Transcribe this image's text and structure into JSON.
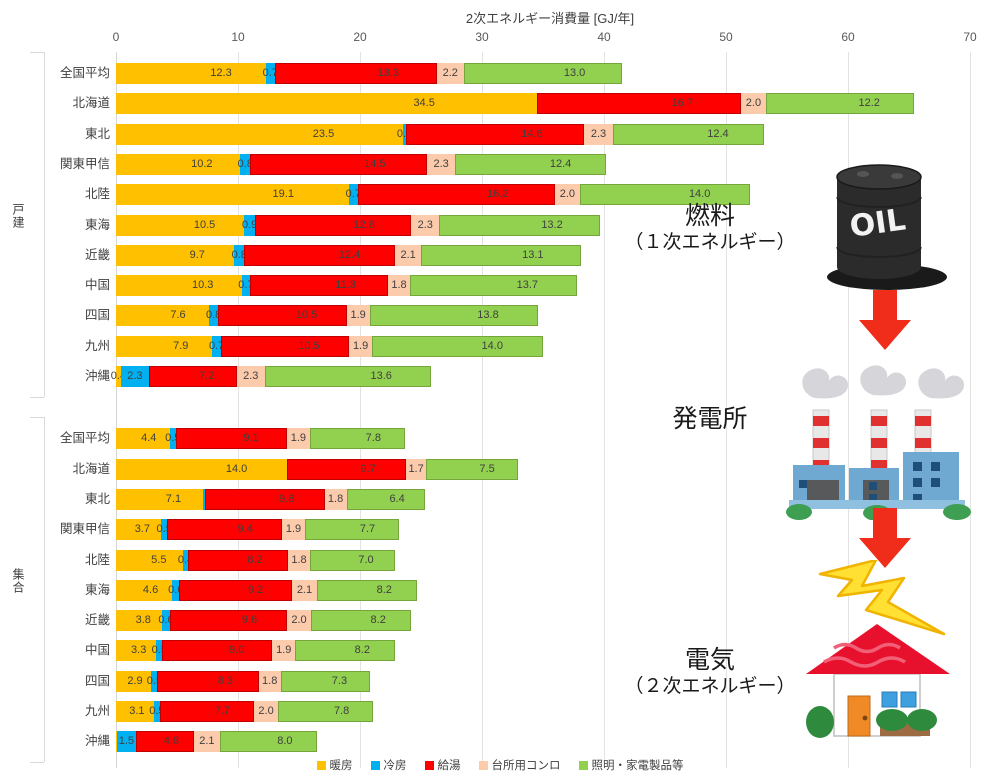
{
  "chart_data": {
    "type": "bar",
    "orientation": "horizontal",
    "stacked": true,
    "title": "2次エネルギー消費量 [GJ/年]",
    "xlabel": "",
    "ylabel": "",
    "xlim": [
      0,
      70
    ],
    "xticks": [
      0,
      10,
      20,
      30,
      40,
      50,
      60,
      70
    ],
    "grid": true,
    "legend_position": "bottom",
    "series": [
      {
        "name": "暖房",
        "color": "#FFC000"
      },
      {
        "name": "冷房",
        "color": "#00B0F0"
      },
      {
        "name": "給湯",
        "color": "#FF0000"
      },
      {
        "name": "台所用コンロ",
        "color": "#FBCBAC"
      },
      {
        "name": "照明・家電製品等",
        "color": "#92D050"
      }
    ],
    "groups": [
      {
        "label": "戸建",
        "categories": [
          "全国平均",
          "北海道",
          "東北",
          "関東甲信",
          "北陸",
          "東海",
          "近畿",
          "中国",
          "四国",
          "九州",
          "沖縄"
        ],
        "values": [
          [
            12.3,
            0.7,
            13.3,
            2.2,
            13.0
          ],
          [
            34.5,
            0.0,
            16.7,
            2.0,
            12.2
          ],
          [
            23.5,
            0.3,
            14.6,
            2.3,
            12.4
          ],
          [
            10.2,
            0.8,
            14.5,
            2.3,
            12.4
          ],
          [
            19.1,
            0.7,
            16.2,
            2.0,
            14.0
          ],
          [
            10.5,
            0.9,
            12.8,
            2.3,
            13.2
          ],
          [
            9.7,
            0.8,
            12.4,
            2.1,
            13.1
          ],
          [
            10.3,
            0.7,
            11.3,
            1.8,
            13.7
          ],
          [
            7.6,
            0.8,
            10.5,
            1.9,
            13.8
          ],
          [
            7.9,
            0.7,
            10.5,
            1.9,
            14.0
          ],
          [
            0.4,
            2.3,
            7.2,
            2.3,
            13.6
          ]
        ]
      },
      {
        "label": "集合",
        "categories": [
          "全国平均",
          "北海道",
          "東北",
          "関東甲信",
          "北陸",
          "東海",
          "近畿",
          "中国",
          "四国",
          "九州",
          "沖縄"
        ],
        "values": [
          [
            4.4,
            0.5,
            9.1,
            1.9,
            7.8
          ],
          [
            14.0,
            0.0,
            9.7,
            1.7,
            7.5
          ],
          [
            7.1,
            0.2,
            9.8,
            1.8,
            6.4
          ],
          [
            3.7,
            0.5,
            9.4,
            1.9,
            7.7
          ],
          [
            5.5,
            0.4,
            8.2,
            1.8,
            7.0
          ],
          [
            4.6,
            0.6,
            9.2,
            2.1,
            8.2
          ],
          [
            3.8,
            0.6,
            9.6,
            2.0,
            8.2
          ],
          [
            3.3,
            0.5,
            9.0,
            1.9,
            8.2
          ],
          [
            2.9,
            0.5,
            8.3,
            1.8,
            7.3
          ],
          [
            3.1,
            0.5,
            7.7,
            2.0,
            7.8
          ],
          [
            0.1,
            1.5,
            4.8,
            2.1,
            8.0
          ]
        ]
      }
    ]
  },
  "legend": {
    "items": [
      {
        "label": "暖房",
        "color": "#FFC000"
      },
      {
        "label": "冷房",
        "color": "#00B0F0"
      },
      {
        "label": "給湯",
        "color": "#FF0000"
      },
      {
        "label": "台所用コンロ",
        "color": "#FBCBAC"
      },
      {
        "label": "照明・家電製品等",
        "color": "#92D050"
      }
    ]
  },
  "illustration": {
    "fuel": {
      "title": "燃料",
      "subtitle": "（１次エネルギー）",
      "art": "oil-drum-icon"
    },
    "plant": {
      "title": "発電所",
      "subtitle": "",
      "art": "power-plant-icon"
    },
    "electricity": {
      "title": "電気",
      "subtitle": "（２次エネルギー）",
      "art": "house-icon"
    },
    "arrows": [
      "down-arrow-icon",
      "down-arrow-icon"
    ],
    "bolt": "lightning-bolt-icon"
  }
}
